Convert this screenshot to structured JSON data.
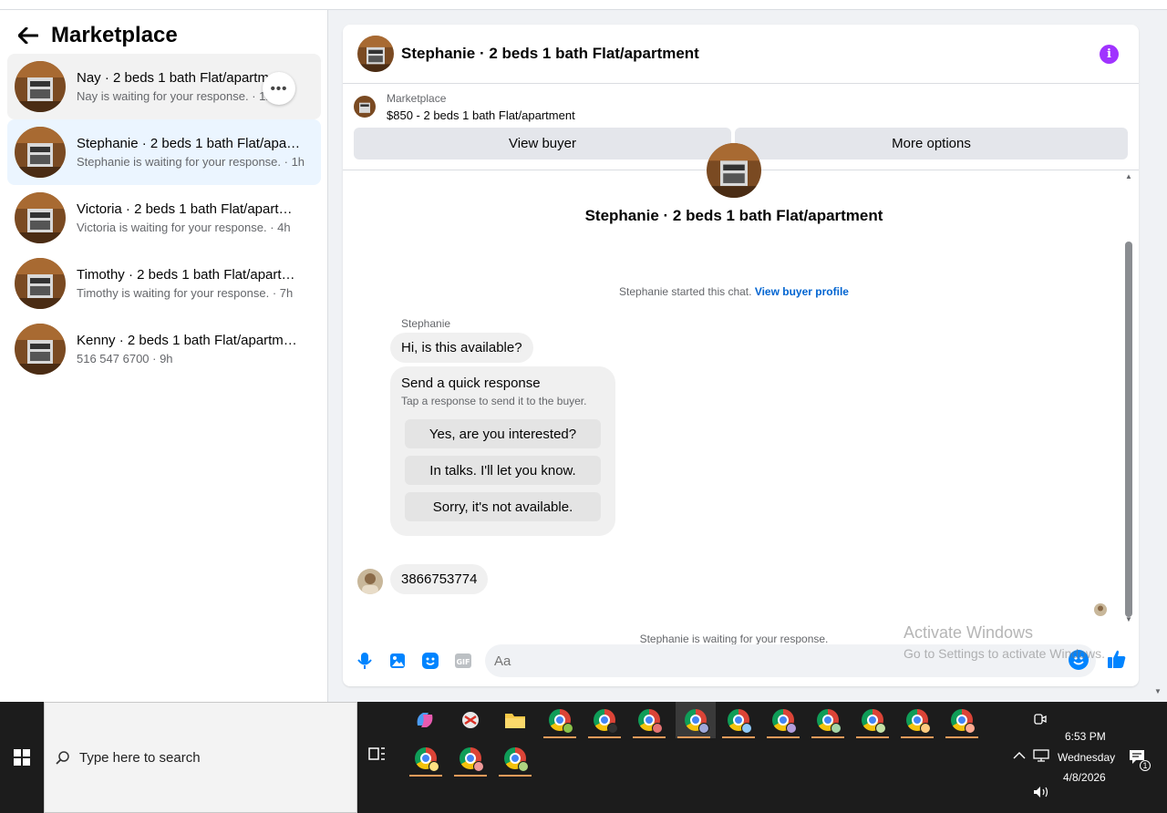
{
  "marketplace": {
    "title": "Marketplace",
    "conversations": [
      {
        "name": "Nay · 2 beds 1 bath Flat/apartm…",
        "sub": "Nay is waiting for your response. · 1h"
      },
      {
        "name": "Stephanie · 2 beds 1 bath Flat/apar…",
        "sub": "Stephanie is waiting for your response. · 1h"
      },
      {
        "name": "Victoria · 2 beds 1 bath Flat/apart…",
        "sub": "Victoria is waiting for your response. · 4h"
      },
      {
        "name": "Timothy · 2 beds 1 bath Flat/apart…",
        "sub": "Timothy is waiting for your response. · 7h"
      },
      {
        "name": "Kenny · 2 beds 1 bath Flat/apartm…",
        "sub": "516 547 6700 · 9h"
      }
    ],
    "more_label": "•••"
  },
  "chat": {
    "title": "Stephanie · 2 beds 1 bath Flat/apartment",
    "info_label": "i",
    "listing_label": "Marketplace",
    "listing_price": "$850 - 2 beds 1 bath Flat/apartment",
    "view_buyer": "View buyer",
    "more_options": "More options",
    "hero_name": "Stephanie · 2 beds 1 bath Flat/apartment",
    "started_text": "Stephanie started this chat.",
    "view_profile": "View buyer profile",
    "sender": "Stephanie",
    "msg1": "Hi, is this available?",
    "quick_title": "Send a quick response",
    "quick_sub": "Tap a response to send it to the buyer.",
    "quick_options": [
      "Yes, are you interested?",
      "In talks. I'll let you know.",
      "Sorry, it's not available."
    ],
    "msg2": "3866753774",
    "waiting": "Stephanie is waiting for your response.",
    "input_placeholder": "Aa"
  },
  "watermark": {
    "line1": "Activate Windows",
    "line2": "Go to Settings to activate Windows."
  },
  "taskbar": {
    "search_placeholder": "Type here to search",
    "time": "6:53 PM",
    "day": "Wednesday",
    "date": "4/8/2026",
    "notification_count": "1"
  },
  "colors": {
    "accent": "#0064d1",
    "active_conv": "#ebf5ff",
    "info": "#a033ff",
    "taskbar": "#1c1c1c"
  }
}
